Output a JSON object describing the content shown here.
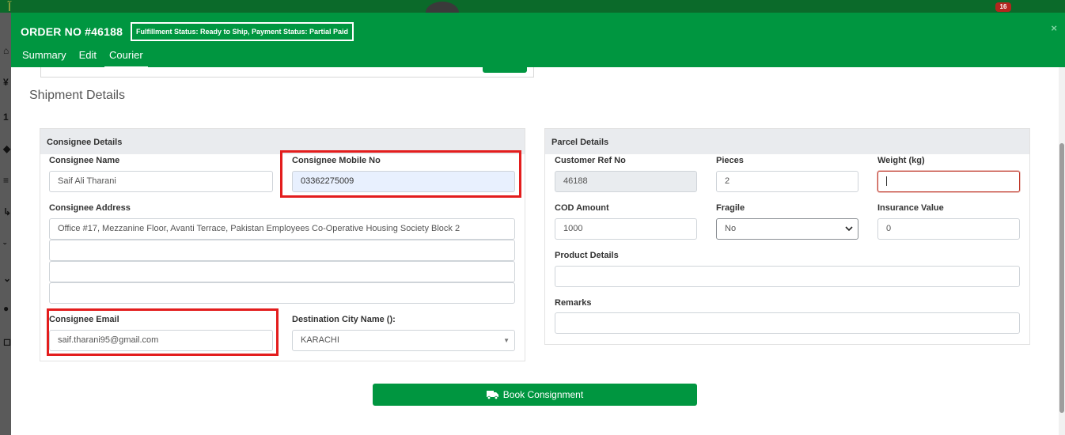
{
  "background": {
    "notification_count": "16"
  },
  "header": {
    "order_title": "ORDER NO #46188",
    "status_text": "Fulfillment Status: Ready to Ship,  Payment Status: Partial Paid",
    "close_label": "×",
    "tabs": [
      {
        "label": "Summary"
      },
      {
        "label": "Edit"
      },
      {
        "label": "Courier"
      }
    ],
    "active_tab": "Courier"
  },
  "section_title": "Shipment Details",
  "consignee": {
    "heading": "Consignee Details",
    "name_label": "Consignee Name",
    "name_value": "Saif Ali Tharani",
    "mobile_label": "Consignee Mobile No",
    "mobile_value": "03362275009",
    "address_label": "Consignee Address",
    "address_lines": [
      "Office #17, Mezzanine Floor, Avanti Terrace, Pakistan Employees Co-Operative Housing Society Block 2",
      "",
      "",
      ""
    ],
    "email_label": "Consignee Email",
    "email_value": "saif.tharani95@gmail.com",
    "city_label": "Destination City Name ():",
    "city_value": "KARACHI"
  },
  "parcel": {
    "heading": "Parcel Details",
    "ref_label": "Customer Ref No",
    "ref_value": "46188",
    "pieces_label": "Pieces",
    "pieces_value": "2",
    "weight_label": "Weight (kg)",
    "weight_value": "",
    "cod_label": "COD Amount",
    "cod_value": "1000",
    "fragile_label": "Fragile",
    "fragile_value": "No",
    "insurance_label": "Insurance Value",
    "insurance_value": "0",
    "product_label": "Product Details",
    "product_value": "",
    "remarks_label": "Remarks",
    "remarks_value": ""
  },
  "book_button_label": "Book Consignment",
  "colors": {
    "primary_green": "#009640",
    "highlight_red": "#e31d1d",
    "panel_header": "#e9ebee"
  }
}
